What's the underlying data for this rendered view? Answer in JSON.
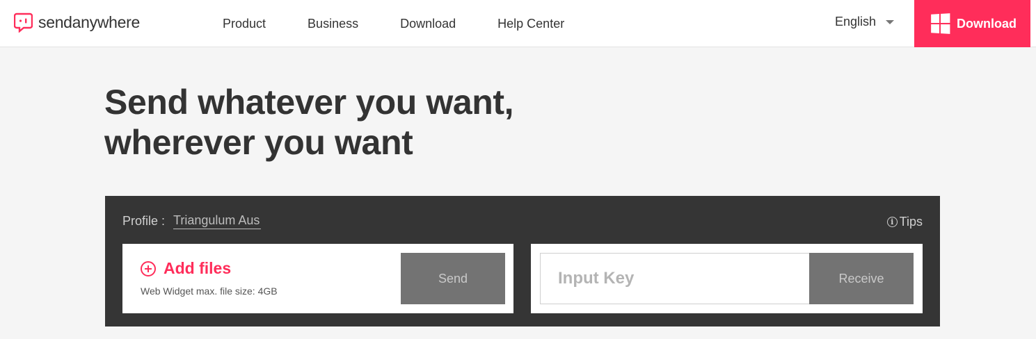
{
  "brand": {
    "name": "sendanywhere",
    "logo_icon": "sendanywhere-logo-icon",
    "accent_color": "#ff2d5a"
  },
  "nav": {
    "items": [
      {
        "label": "Product"
      },
      {
        "label": "Business"
      },
      {
        "label": "Download"
      },
      {
        "label": "Help Center"
      }
    ]
  },
  "language": {
    "selected": "English",
    "icon": "chevron-down-icon"
  },
  "header_download": {
    "label": "Download",
    "icon": "windows-icon"
  },
  "hero": {
    "line1": "Send whatever you want,",
    "line2": "wherever you want"
  },
  "widget": {
    "profile_label": "Profile :",
    "profile_name": "Triangulum Aus",
    "tips_label": "Tips",
    "tips_icon": "info-icon",
    "send": {
      "add_files_label": "Add files",
      "add_icon": "plus-circle-icon",
      "size_note": "Web Widget max. file size: 4GB",
      "button_label": "Send"
    },
    "receive": {
      "input_placeholder": "Input Key",
      "input_value": "",
      "button_label": "Receive"
    }
  }
}
